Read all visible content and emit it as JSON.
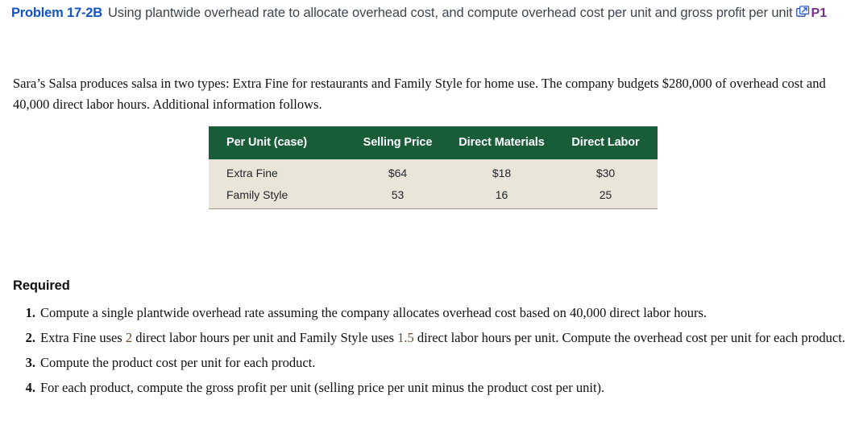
{
  "header": {
    "problem_label": "Problem 17-2B",
    "title": "Using plantwide overhead rate to allocate overhead cost, and compute overhead cost per unit and gross profit per unit",
    "title_line1": "Using plantwide overhead rate to allocate overhead cost, and compute overhead cost per unit",
    "title_line2": "and gross profit per unit",
    "icon": "popup-window-icon",
    "badge": "P1",
    "label_color": "#1455c0",
    "badge_color": "#7b2d8e"
  },
  "intro": {
    "text": "Sara’s Salsa produces salsa in two types: Extra Fine for restaurants and Family Style for home use. The company budgets $280,000 of overhead cost and 40,000 direct labor hours. Additional information follows."
  },
  "table": {
    "header_bg": "#185c38",
    "row_bg": "#e9e5d9",
    "columns": [
      "Per Unit (case)",
      "Selling Price",
      "Direct Materials",
      "Direct Labor"
    ],
    "rows": [
      {
        "label": "Extra Fine",
        "selling_price": "$64",
        "direct_materials": "$18",
        "direct_labor": "$30"
      },
      {
        "label": "Family Style",
        "selling_price": "53",
        "direct_materials": "16",
        "direct_labor": "25"
      }
    ]
  },
  "required": {
    "heading": "Required",
    "items": [
      {
        "number": "1.",
        "text": "Compute a single plantwide overhead rate assuming the company allocates overhead cost based on 40,000 direct labor hours."
      },
      {
        "number": "2.",
        "text_before": "Extra Fine uses ",
        "value_1": "2",
        "text_middle": " direct labor hours per unit and Family Style uses ",
        "value_2": "1.5",
        "text_after": " direct labor hours per unit. Compute the overhead cost per unit for each product."
      },
      {
        "number": "3.",
        "text": "Compute the product cost per unit for each product."
      },
      {
        "number": "4.",
        "text": "For each product, compute the gross profit per unit (selling price per unit minus the product cost per unit)."
      }
    ]
  }
}
